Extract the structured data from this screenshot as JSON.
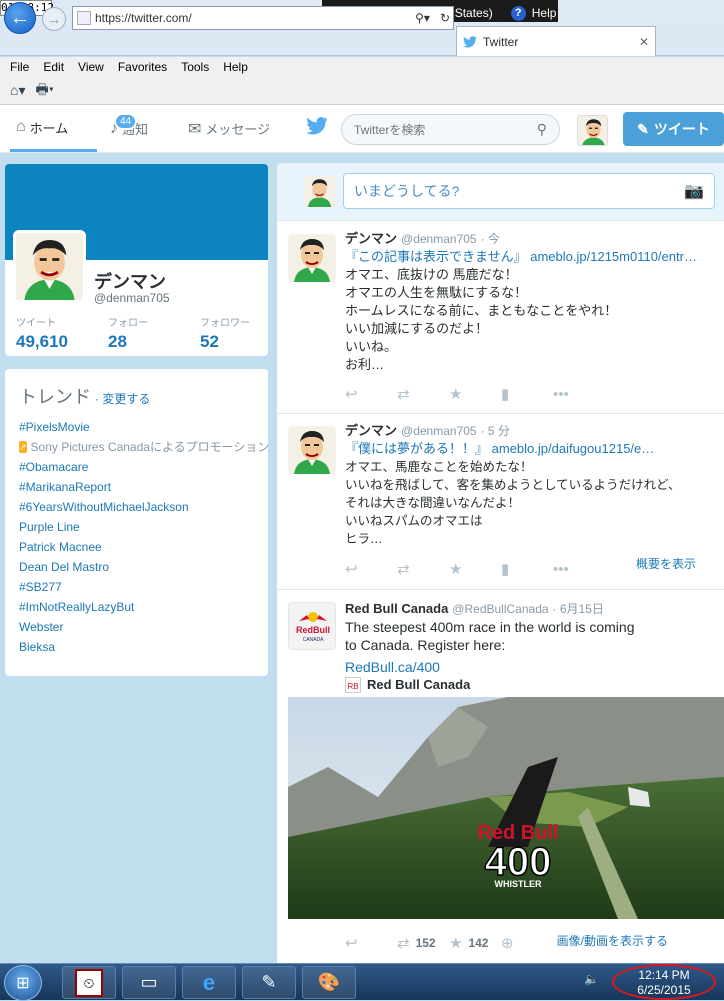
{
  "system": {
    "clock": "01:48:12",
    "language": "EN English (United States)",
    "help": "Help"
  },
  "browser": {
    "url": "https://twitter.com/",
    "tab_title": "Twitter",
    "menu": [
      "File",
      "Edit",
      "View",
      "Favorites",
      "Tools",
      "Help"
    ]
  },
  "twitter_nav": {
    "home": "ホーム",
    "notifications": "通知",
    "notifications_badge": "44",
    "messages": "メッセージ",
    "search_placeholder": "Twitterを検索",
    "tweet_button": "ツイート"
  },
  "profile": {
    "name": "デンマン",
    "handle": "@denman705",
    "stats": [
      {
        "label": "ツイート",
        "value": "49,610"
      },
      {
        "label": "フォロー",
        "value": "28"
      },
      {
        "label": "フォロワー",
        "value": "52"
      }
    ]
  },
  "trends": {
    "title": "トレンド",
    "change": "· 変更する",
    "items": [
      {
        "text": "#PixelsMovie",
        "promoted": false
      },
      {
        "text": "Sony Pictures Canadaによるプロモーション",
        "promoted": true
      },
      {
        "text": "#Obamacare",
        "promoted": false
      },
      {
        "text": "#MarikanaReport",
        "promoted": false
      },
      {
        "text": "#6YearsWithoutMichaelJackson",
        "promoted": false
      },
      {
        "text": "Purple Line",
        "promoted": false
      },
      {
        "text": "Patrick Macnee",
        "promoted": false
      },
      {
        "text": "Dean Del Mastro",
        "promoted": false
      },
      {
        "text": "#SB277",
        "promoted": false
      },
      {
        "text": "#ImNotReallyLazyBut",
        "promoted": false
      },
      {
        "text": "Webster",
        "promoted": false
      },
      {
        "text": "Bieksa",
        "promoted": false
      }
    ]
  },
  "composer": {
    "placeholder": "いまどうしてる?"
  },
  "tweets": [
    {
      "name": "デンマン",
      "handle": "@denman705",
      "time": "· 今",
      "lead": "『この記事は表示できません』",
      "link": "ameblo.jp/1215m0110/entr…",
      "text": "オマエ、底抜けの 馬鹿だな！\nオマエの人生を無駄にするな！\nホームレスになる前に、まともなことをやれ！\nいい加減にするのだよ！\nいいね。\nお利…"
    },
    {
      "name": "デンマン",
      "handle": "@denman705",
      "time": "· 5 分",
      "lead": "『僕には夢がある！！』",
      "link": "ameblo.jp/daifugou1215/e…",
      "text": "オマエ、馬鹿なことを始めたな！\nいいねを飛ばして、客を集めようとしているようだけれど、\nそれは大きな間違いなんだよ！\nいいねスパムのオマエは\nヒラ…",
      "expand": "概要を表示"
    },
    {
      "name": "Red Bull Canada",
      "handle": "@RedBullCanada",
      "time": "· 6月15日",
      "text": "The steepest 400m race in the world is coming\nto Canada. Register here:",
      "link": "RedBull.ca/400",
      "card_name": "Red Bull Canada",
      "retweets": "152",
      "likes": "142",
      "expand": "画像/動画を表示する",
      "media_text": {
        "brand": "Red Bull",
        "number": "400",
        "sub": "WHISTLER"
      }
    }
  ],
  "taskbar": {
    "time": "12:14 PM",
    "date": "6/25/2015"
  }
}
